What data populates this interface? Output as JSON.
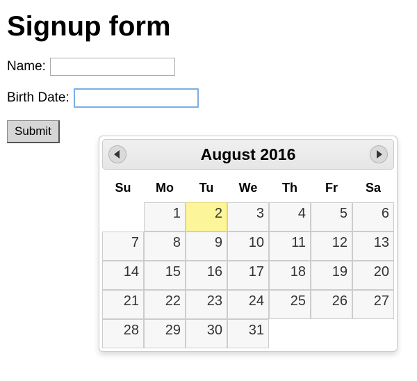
{
  "page": {
    "title": "Signup form"
  },
  "form": {
    "name_label": "Name:",
    "name_value": "",
    "birth_label": "Birth Date:",
    "birth_value": "",
    "submit_label": "Submit"
  },
  "datepicker": {
    "title": "August 2016",
    "dow": [
      "Su",
      "Mo",
      "Tu",
      "We",
      "Th",
      "Fr",
      "Sa"
    ],
    "today": 2,
    "weeks": [
      [
        "",
        "1",
        "2",
        "3",
        "4",
        "5",
        "6"
      ],
      [
        "7",
        "8",
        "9",
        "10",
        "11",
        "12",
        "13"
      ],
      [
        "14",
        "15",
        "16",
        "17",
        "18",
        "19",
        "20"
      ],
      [
        "21",
        "22",
        "23",
        "24",
        "25",
        "26",
        "27"
      ],
      [
        "28",
        "29",
        "30",
        "31",
        "",
        "",
        ""
      ]
    ]
  }
}
